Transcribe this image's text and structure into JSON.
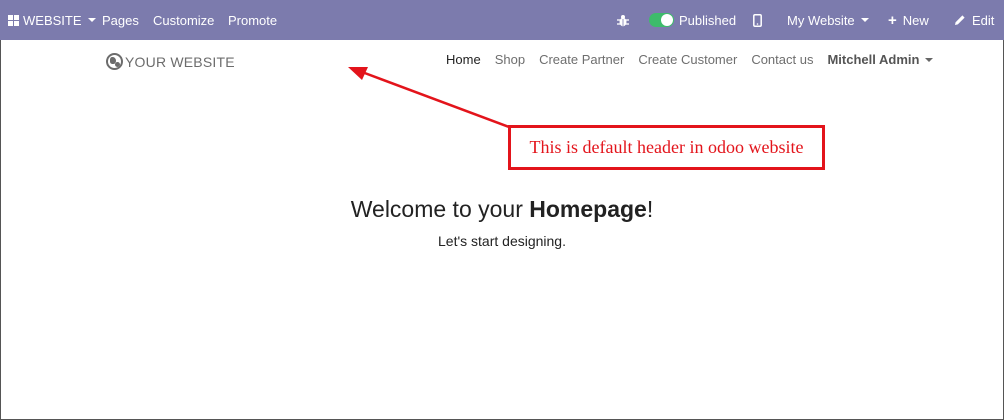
{
  "topbar": {
    "apps_label": "WEBSITE",
    "menu": [
      "Pages",
      "Customize",
      "Promote"
    ],
    "published_label": "Published",
    "my_website_label": "My Website",
    "new_label": "New",
    "edit_label": "Edit",
    "background_color": "#7c7bad",
    "toggle_color": "#3dbb6b"
  },
  "header": {
    "logo_text": "YOUR WEBSITE",
    "nav": [
      "Home",
      "Shop",
      "Create Partner",
      "Create Customer",
      "Contact us"
    ],
    "user_label": "Mitchell Admin"
  },
  "hero": {
    "title_prefix": "Welcome to your ",
    "title_bold": "Homepage",
    "title_suffix": "!",
    "subtitle": "Let's start designing."
  },
  "annotation": {
    "text": "This is default header in odoo website",
    "color": "#e3141b"
  }
}
